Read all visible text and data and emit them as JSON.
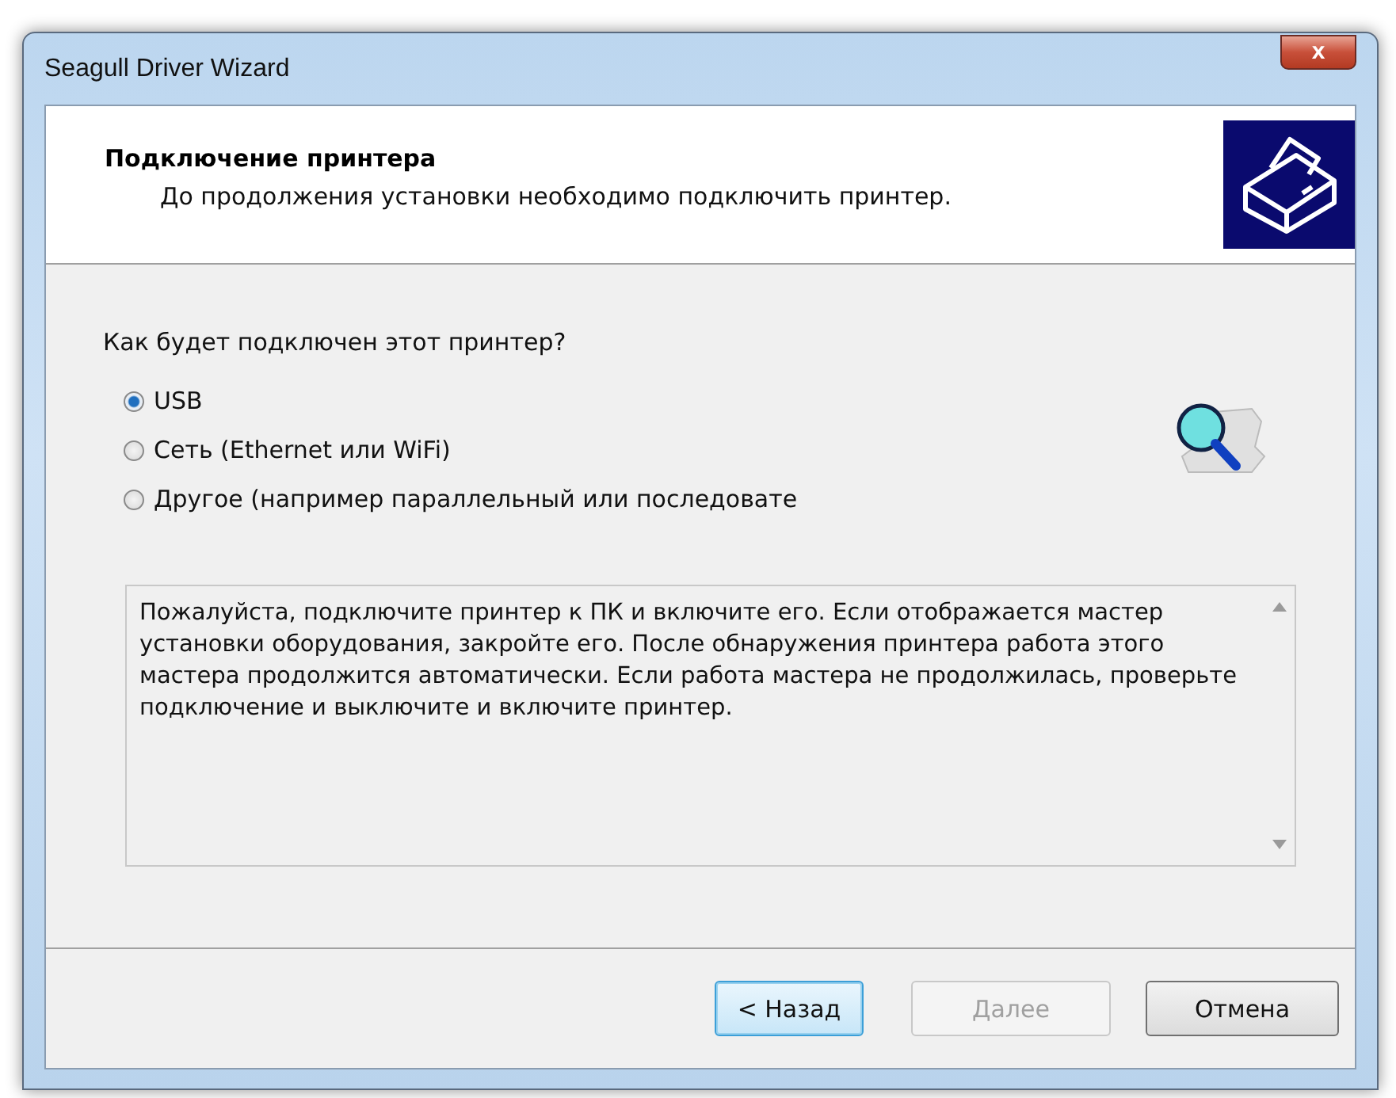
{
  "window": {
    "title": "Seagull Driver Wizard",
    "close_label": "x"
  },
  "header": {
    "title": "Подключение принтера",
    "subtitle": "До продолжения установки необходимо подключить принтер."
  },
  "question": "Как будет подключен этот принтер?",
  "options": [
    {
      "label": "USB",
      "selected": true
    },
    {
      "label": "Сеть (Ethernet или WiFi)",
      "selected": false
    },
    {
      "label": "Другое (например параллельный или последовате",
      "selected": false
    }
  ],
  "info_text": "Пожалуйста, подключите принтер к ПК и включите его. Если отображается мастер установки оборудования, закройте его. После обнаружения принтера работа этого мастера продолжится автоматически. Если работа мастера не продолжилась, проверьте подключение и выключите и включите принтер.",
  "buttons": [
    {
      "label": "< Назад",
      "focused": true,
      "disabled": false
    },
    {
      "label": "Далее",
      "focused": false,
      "disabled": true
    },
    {
      "label": "Отмена",
      "focused": false,
      "disabled": false
    }
  ]
}
